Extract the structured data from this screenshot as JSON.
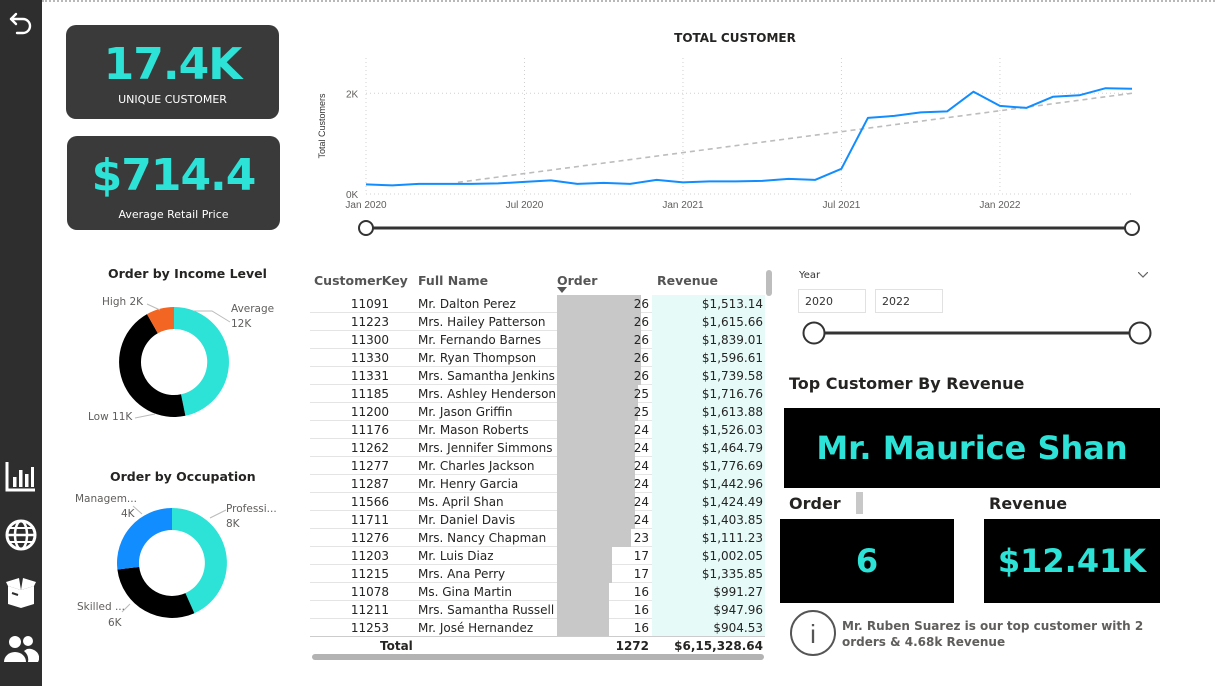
{
  "kpis": {
    "unique_customer": {
      "value": "17.4K",
      "label": "UNIQUE CUSTOMER"
    },
    "avg_retail_price": {
      "value": "$714.4",
      "label": "Average Retail Price"
    }
  },
  "income_donut": {
    "title": "Order by Income Level",
    "labels": {
      "high": "High 2K",
      "average_name": "Average",
      "average_value": "12K",
      "low": "Low 11K"
    }
  },
  "occupation_donut": {
    "title": "Order by Occupation",
    "labels": {
      "mgmt_name": "Managem...",
      "mgmt_value": "4K",
      "prof_name": "Professi...",
      "prof_value": "8K",
      "skilled_name": "Skilled ...",
      "skilled_value": "6K"
    }
  },
  "line_chart": {
    "title": "TOTAL CUSTOMER",
    "ylabel": "Total Customers",
    "yticks": [
      "0K",
      "2K"
    ],
    "xticks": [
      "Jan 2020",
      "Jul 2020",
      "Jan 2021",
      "Jul 2021",
      "Jan 2022"
    ]
  },
  "chart_data": {
    "type": "line",
    "title": "TOTAL CUSTOMER",
    "xlabel": "",
    "ylabel": "Total Customers",
    "ylim": [
      0,
      2700
    ],
    "x": [
      "2020-01",
      "2020-02",
      "2020-03",
      "2020-04",
      "2020-05",
      "2020-06",
      "2020-07",
      "2020-08",
      "2020-09",
      "2020-10",
      "2020-11",
      "2020-12",
      "2021-01",
      "2021-02",
      "2021-03",
      "2021-04",
      "2021-05",
      "2021-06",
      "2021-07",
      "2021-08",
      "2021-09",
      "2021-10",
      "2021-11",
      "2021-12",
      "2022-01",
      "2022-02",
      "2022-03",
      "2022-04",
      "2022-05",
      "2022-06"
    ],
    "series": [
      {
        "values": [
          190,
          170,
          200,
          200,
          200,
          210,
          240,
          270,
          200,
          220,
          200,
          280,
          230,
          250,
          250,
          260,
          300,
          280,
          500,
          1510,
          1550,
          1620,
          1640,
          2030,
          1750,
          1710,
          1930,
          1960,
          2100,
          2090
        ]
      }
    ],
    "trendline": [
      -10,
      2000
    ],
    "grid": true
  },
  "table": {
    "headers": {
      "key": "CustomerKey",
      "name": "Full Name",
      "order": "Order",
      "revenue": "Revenue"
    },
    "rows": [
      {
        "key": "11091",
        "name": "Mr. Dalton Perez",
        "order": "26",
        "revenue": "$1,513.14"
      },
      {
        "key": "11223",
        "name": "Mrs. Hailey Patterson",
        "order": "26",
        "revenue": "$1,615.66"
      },
      {
        "key": "11300",
        "name": "Mr. Fernando Barnes",
        "order": "26",
        "revenue": "$1,839.01"
      },
      {
        "key": "11330",
        "name": "Mr. Ryan Thompson",
        "order": "26",
        "revenue": "$1,596.61"
      },
      {
        "key": "11331",
        "name": "Mrs. Samantha Jenkins",
        "order": "26",
        "revenue": "$1,739.58"
      },
      {
        "key": "11185",
        "name": "Mrs. Ashley Henderson",
        "order": "25",
        "revenue": "$1,716.76"
      },
      {
        "key": "11200",
        "name": "Mr. Jason Griffin",
        "order": "25",
        "revenue": "$1,613.88"
      },
      {
        "key": "11176",
        "name": "Mr. Mason Roberts",
        "order": "24",
        "revenue": "$1,526.03"
      },
      {
        "key": "11262",
        "name": "Mrs. Jennifer Simmons",
        "order": "24",
        "revenue": "$1,464.79"
      },
      {
        "key": "11277",
        "name": "Mr. Charles Jackson",
        "order": "24",
        "revenue": "$1,776.69"
      },
      {
        "key": "11287",
        "name": "Mr. Henry Garcia",
        "order": "24",
        "revenue": "$1,442.96"
      },
      {
        "key": "11566",
        "name": "Ms. April Shan",
        "order": "24",
        "revenue": "$1,424.49"
      },
      {
        "key": "11711",
        "name": "Mr. Daniel Davis",
        "order": "24",
        "revenue": "$1,403.85"
      },
      {
        "key": "11276",
        "name": "Mrs. Nancy Chapman",
        "order": "23",
        "revenue": "$1,111.23"
      },
      {
        "key": "11203",
        "name": "Mr. Luis Diaz",
        "order": "17",
        "revenue": "$1,002.05"
      },
      {
        "key": "11215",
        "name": "Mrs. Ana Perry",
        "order": "17",
        "revenue": "$1,335.85"
      },
      {
        "key": "11078",
        "name": "Ms. Gina Martin",
        "order": "16",
        "revenue": "$991.27"
      },
      {
        "key": "11211",
        "name": "Mrs. Samantha Russell",
        "order": "16",
        "revenue": "$947.96"
      },
      {
        "key": "11253",
        "name": "Mr. José Hernandez",
        "order": "16",
        "revenue": "$904.53"
      }
    ],
    "total": {
      "label": "Total",
      "order": "1272",
      "revenue": "$6,15,328.64"
    }
  },
  "year_slicer": {
    "label": "Year",
    "from": "2020",
    "to": "2022"
  },
  "top_customer": {
    "title": "Top Customer By Revenue",
    "name": "Mr. Maurice Shan",
    "order_label": "Order",
    "order_value": "6",
    "revenue_label": "Revenue",
    "revenue_value": "$12.41K",
    "info_text": "Mr. Ruben Suarez is our top customer with 2 orders & 4.68k Revenue"
  },
  "colors": {
    "accent": "#2de2d6",
    "line": "#118dff",
    "orange": "#f26522",
    "dark": "#000000"
  }
}
